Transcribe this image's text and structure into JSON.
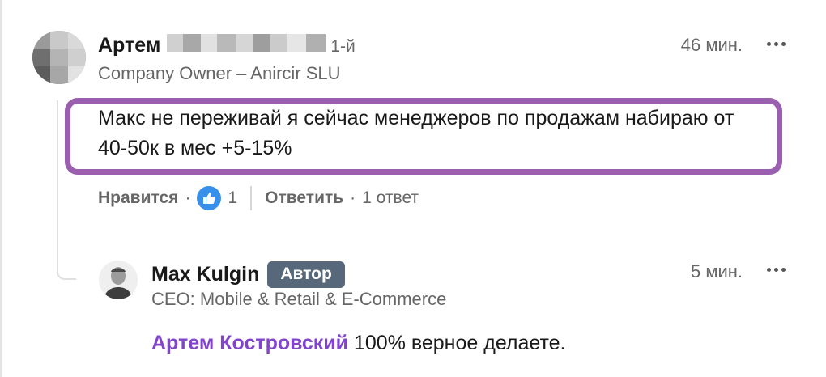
{
  "comment": {
    "author_first_name": "Артем",
    "connection_degree": "1-й",
    "headline": "Company Owner – Anircir SLU",
    "timestamp": "46 мин.",
    "text": "Макс не переживай я сейчас менеджеров по продажам набираю от 40-50к в мес +5-15%",
    "actions": {
      "like_label": "Нравится",
      "reaction_count": "1",
      "reply_label": "Ответить",
      "replies_count_label": "1 ответ"
    }
  },
  "reply": {
    "author_name": "Max Kulgin",
    "badge": "Автор",
    "headline": "CEO: Mobile & Retail & E-Commerce",
    "timestamp": "5 мин.",
    "mention": "Артем Костровский",
    "text": " 100% верное делаете."
  },
  "colors": {
    "highlight_border": "#9b5fb0",
    "mention": "#8344cc",
    "badge_bg": "#56687a",
    "like_icon": "#378fe9",
    "secondary_text": "#666666"
  },
  "icons": {
    "more": "more-horizontal-icon",
    "like": "like-reaction-icon"
  }
}
